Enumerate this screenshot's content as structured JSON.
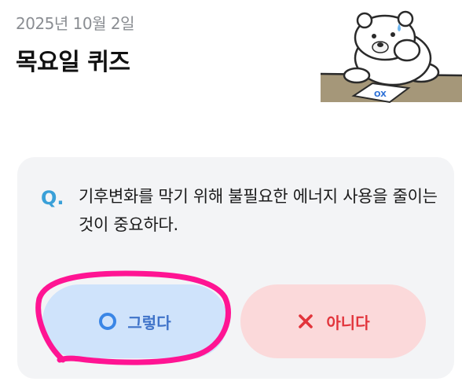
{
  "header": {
    "date": "2025년 10월 2일",
    "title": "목요일 퀴즈"
  },
  "mascot": {
    "icon": "polar-bear-icon",
    "paper_text": "OX"
  },
  "quiz": {
    "q_label": "Q.",
    "question": "기후변화를 막기 위해 불필요한 에너지 사용을 줄이는 것이 중요하다.",
    "answer_yes": {
      "label": "그렇다",
      "icon": "circle-o-icon",
      "bg": "#cfe3fb",
      "color": "#3f73c9"
    },
    "answer_no": {
      "label": "아니다",
      "icon": "x-icon",
      "bg": "#fbd9da",
      "color": "#e2343b"
    }
  },
  "colors": {
    "q_label": "#3aa0d8",
    "card_bg": "#f3f4f6",
    "highlight": "#ff1493"
  }
}
